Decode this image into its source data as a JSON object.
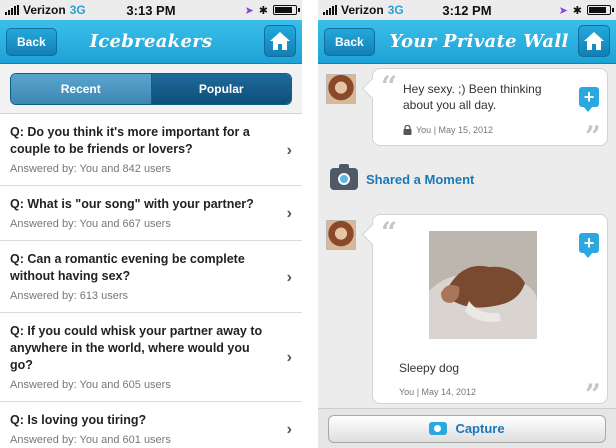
{
  "left_screen": {
    "status": {
      "carrier": "Verizon",
      "network": "3G",
      "time": "3:13 PM"
    },
    "nav": {
      "back_label": "Back",
      "title": "Icebreakers",
      "home_icon": "home-icon"
    },
    "segments": [
      {
        "label": "Recent",
        "selected": false
      },
      {
        "label": "Popular",
        "selected": true
      }
    ],
    "questions": [
      {
        "question": "Q: Do you think it's more important for a couple to be friends or lovers?",
        "answered": "Answered by: You and 842 users"
      },
      {
        "question": "Q: What is \"our song\" with your partner?",
        "answered": "Answered by: You and 667 users"
      },
      {
        "question": "Q: Can a romantic evening be complete without having sex?",
        "answered": "Answered by: 613 users"
      },
      {
        "question": "Q: If you could whisk your partner away to anywhere in the world, where would you go?",
        "answered": "Answered by: You and 605 users"
      },
      {
        "question": "Q: Is loving you tiring?",
        "answered": "Answered by: You and 601 users"
      }
    ]
  },
  "right_screen": {
    "status": {
      "carrier": "Verizon",
      "network": "3G",
      "time": "3:12 PM"
    },
    "nav": {
      "back_label": "Back",
      "title": "Your Private Wall",
      "home_icon": "home-icon"
    },
    "message": {
      "text": "Hey sexy. ;) Been thinking about you all day.",
      "meta": "You | May 15, 2012"
    },
    "shared_moment": {
      "label": "Shared a Moment"
    },
    "photo_post": {
      "caption": "Sleepy dog",
      "meta": "You | May 14, 2012"
    },
    "capture": {
      "label": "Capture"
    }
  },
  "colors": {
    "nav_blue": "#1da2d6",
    "link_blue": "#1a78b8",
    "segment_dark": "#0f4f7a"
  }
}
